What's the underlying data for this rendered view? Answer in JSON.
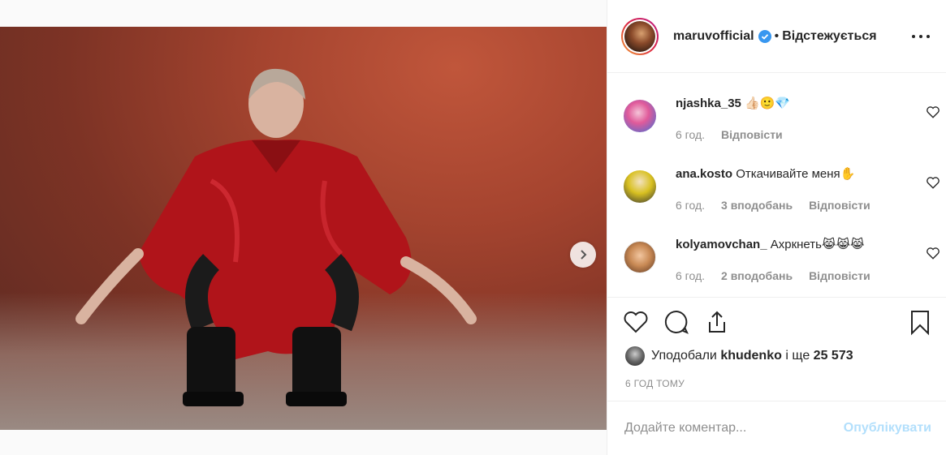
{
  "post": {
    "author": "maruvofficial",
    "verified": true,
    "follow_state": "Відстежується",
    "bullet": "•",
    "carousel": {
      "slides": 3,
      "active_index": 0
    }
  },
  "comments": [
    {
      "user": "njashka_35",
      "text": "👍🏻🙂💎",
      "time": "6 год.",
      "likes": "",
      "reply": "Відповісти",
      "avatar_color": "#e05a9a"
    },
    {
      "user": "ana.kosto",
      "text": "Откачивайте меня✋",
      "time": "6 год.",
      "likes": "3 вподобань",
      "reply": "Відповісти",
      "avatar_color": "#d8c020"
    },
    {
      "user": "kolyamovchan_",
      "text": "Ахркнеть😹😹😹",
      "time": "6 год.",
      "likes": "2 вподобань",
      "reply": "Відповісти",
      "avatar_color": "#c98a55"
    }
  ],
  "likes": {
    "prefix": "Уподобали",
    "user": "khudenko",
    "joiner": "і ще",
    "count": "25 573"
  },
  "timestamp": "6 ГОД ТОМУ",
  "comment_box": {
    "placeholder": "Додайте коментар...",
    "publish_label": "Опублікувати"
  },
  "colors": {
    "publish_disabled": "#b2dffc",
    "verified_blue": "#3897f0",
    "muted": "#8e8e8e"
  }
}
